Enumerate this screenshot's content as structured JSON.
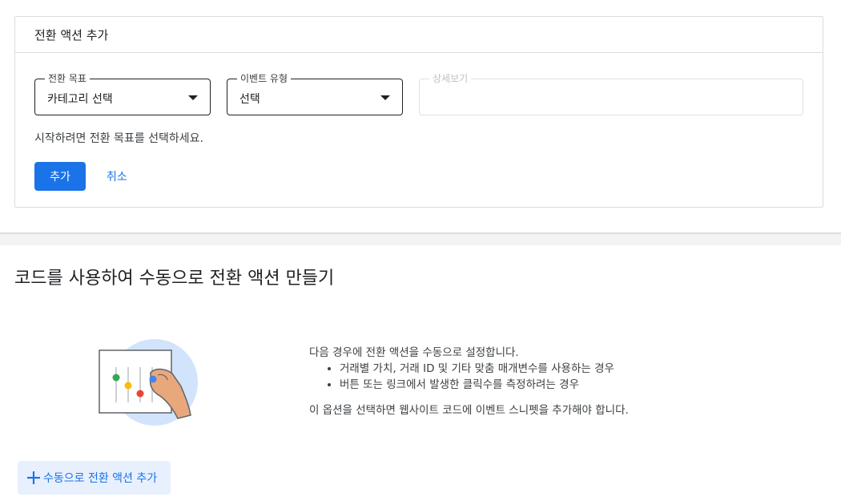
{
  "card": {
    "title": "전환 액션 추가",
    "goal_field": {
      "label": "전환 목표",
      "value": "카테고리 선택"
    },
    "event_field": {
      "label": "이벤트 유형",
      "value": "선택"
    },
    "detail_field": {
      "label": "상세보기",
      "value": ""
    },
    "hint": "시작하려면 전환 목표를 선택하세요.",
    "add_label": "추가",
    "cancel_label": "취소"
  },
  "manual": {
    "title": "코드를 사용하여 수동으로 전환 액션 만들기",
    "intro": "다음 경우에 전환 액션을 수동으로 설정합니다.",
    "bullets": [
      "거래별 가치, 거래 ID 및 기타 맞춤 매개변수를 사용하는 경우",
      "버튼 또는 링크에서 발생한 클릭수를 측정하려는 경우"
    ],
    "note": "이 옵션을 선택하면 웹사이트 코드에 이벤트 스니펫을 추가해야 합니다.",
    "add_manual_label": "수동으로 전환 액션 추가"
  },
  "colors": {
    "primary": "#1a73e8",
    "light_blue": "#e8f0fe",
    "border": "#dadce0",
    "dot_green": "#34a853",
    "dot_yellow": "#fbbc04",
    "dot_red": "#ea4335",
    "dot_blue": "#4285f4"
  },
  "icons": [
    "caret-down-icon",
    "plus-icon",
    "slider-hand-illustration"
  ]
}
